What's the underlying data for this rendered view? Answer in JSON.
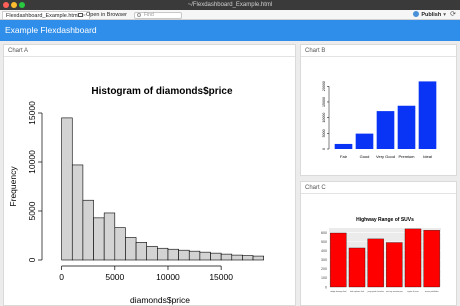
{
  "window": {
    "title": "~/Flexdashboard_Example.html"
  },
  "toolbar": {
    "tab_label": "Flexdashboard_Example.html",
    "tab_close": "×",
    "open_in_browser": "Open in Browser",
    "find_placeholder": "Find",
    "publish_label": "Publish",
    "publish_caret": "▾",
    "refresh_glyph": "⟳"
  },
  "navbar": {
    "brand": "Example Flexdashboard"
  },
  "cards": {
    "a_title": "Chart A",
    "b_title": "Chart B",
    "c_title": "Chart C"
  },
  "colors": {
    "navbar": "#2f8eea",
    "hist_fill": "#d3d3d3",
    "bar_blue": "#0a34f5",
    "bar_red": "#ff0000"
  },
  "chart_data": [
    {
      "type": "bar",
      "title": "Histogram of diamonds$price",
      "xlabel": "diamonds$price",
      "ylabel": "Frequency",
      "bin_width": 1000,
      "bins_start": 0,
      "values": [
        14500,
        9700,
        6100,
        4300,
        4800,
        3300,
        2300,
        1800,
        1400,
        1200,
        1100,
        1000,
        900,
        800,
        700,
        600,
        500,
        450,
        400
      ],
      "xlim": [
        -1000,
        19500
      ],
      "ylim": [
        0,
        15000
      ],
      "xticks": [
        0,
        5000,
        10000,
        15000
      ],
      "yticks": [
        0,
        5000,
        10000,
        15000
      ],
      "grid": false
    },
    {
      "type": "bar",
      "categories": [
        "Fair",
        "Good",
        "Very Good",
        "Premium",
        "Ideal"
      ],
      "values": [
        1610,
        4906,
        12082,
        13791,
        21551
      ],
      "ylim": [
        0,
        22000
      ],
      "yticks": [
        0,
        5000,
        10000,
        15000,
        20000
      ],
      "grid": false
    },
    {
      "type": "bar",
      "title": "Highway Range of SUVs",
      "categories": [
        "dodge durango 4wd",
        "ford explorer 4wd",
        "jeep grand cherokee",
        "mercury mountaineer",
        "toyota 4runner",
        "nissan pathfinder"
      ],
      "values": [
        595,
        430,
        530,
        490,
        640,
        625
      ],
      "ylim": [
        0,
        650
      ],
      "yticks": [
        0,
        100,
        200,
        300,
        400,
        500,
        600
      ],
      "grid": true
    }
  ]
}
